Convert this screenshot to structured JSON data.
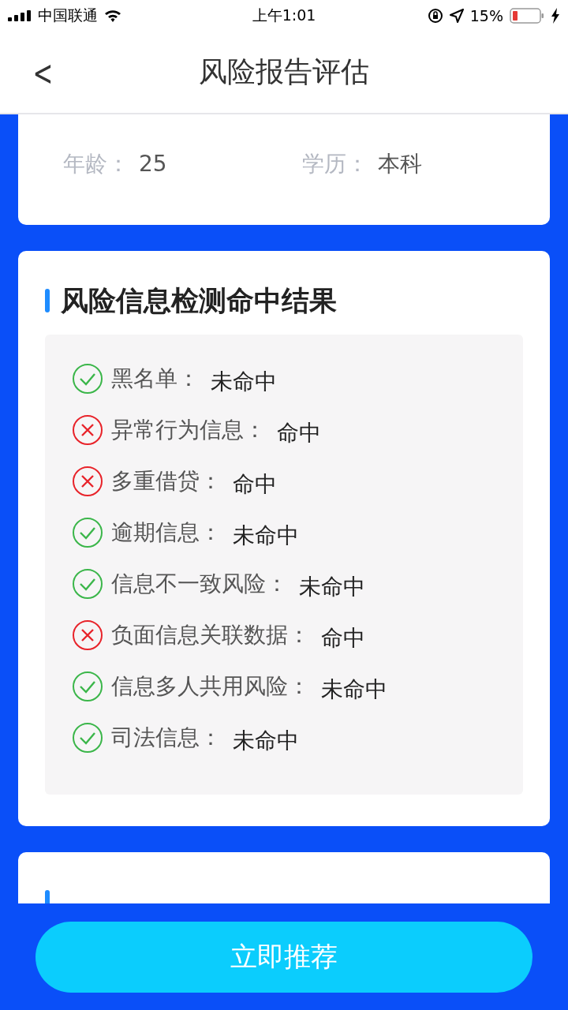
{
  "status_bar": {
    "carrier": "中国联通",
    "time": "上午1:01",
    "battery": "15%"
  },
  "nav": {
    "back": "<",
    "title": "风险报告评估"
  },
  "profile": [
    {
      "label": "年龄：",
      "value": "25"
    },
    {
      "label": "学历：",
      "value": "本科"
    }
  ],
  "risk_section": {
    "title": "风险信息检测命中结果",
    "items": [
      {
        "label": "黑名单：",
        "value": "未命中",
        "hit": false
      },
      {
        "label": "异常行为信息：",
        "value": "命中",
        "hit": true
      },
      {
        "label": "多重借贷：",
        "value": "命中",
        "hit": true
      },
      {
        "label": "逾期信息：",
        "value": "未命中",
        "hit": false
      },
      {
        "label": "信息不一致风险：",
        "value": "未命中",
        "hit": false
      },
      {
        "label": "负面信息关联数据：",
        "value": "命中",
        "hit": true
      },
      {
        "label": "信息多人共用风险：",
        "value": "未命中",
        "hit": false
      },
      {
        "label": "司法信息：",
        "value": "未命中",
        "hit": false
      }
    ]
  },
  "action_button": "立即推荐"
}
